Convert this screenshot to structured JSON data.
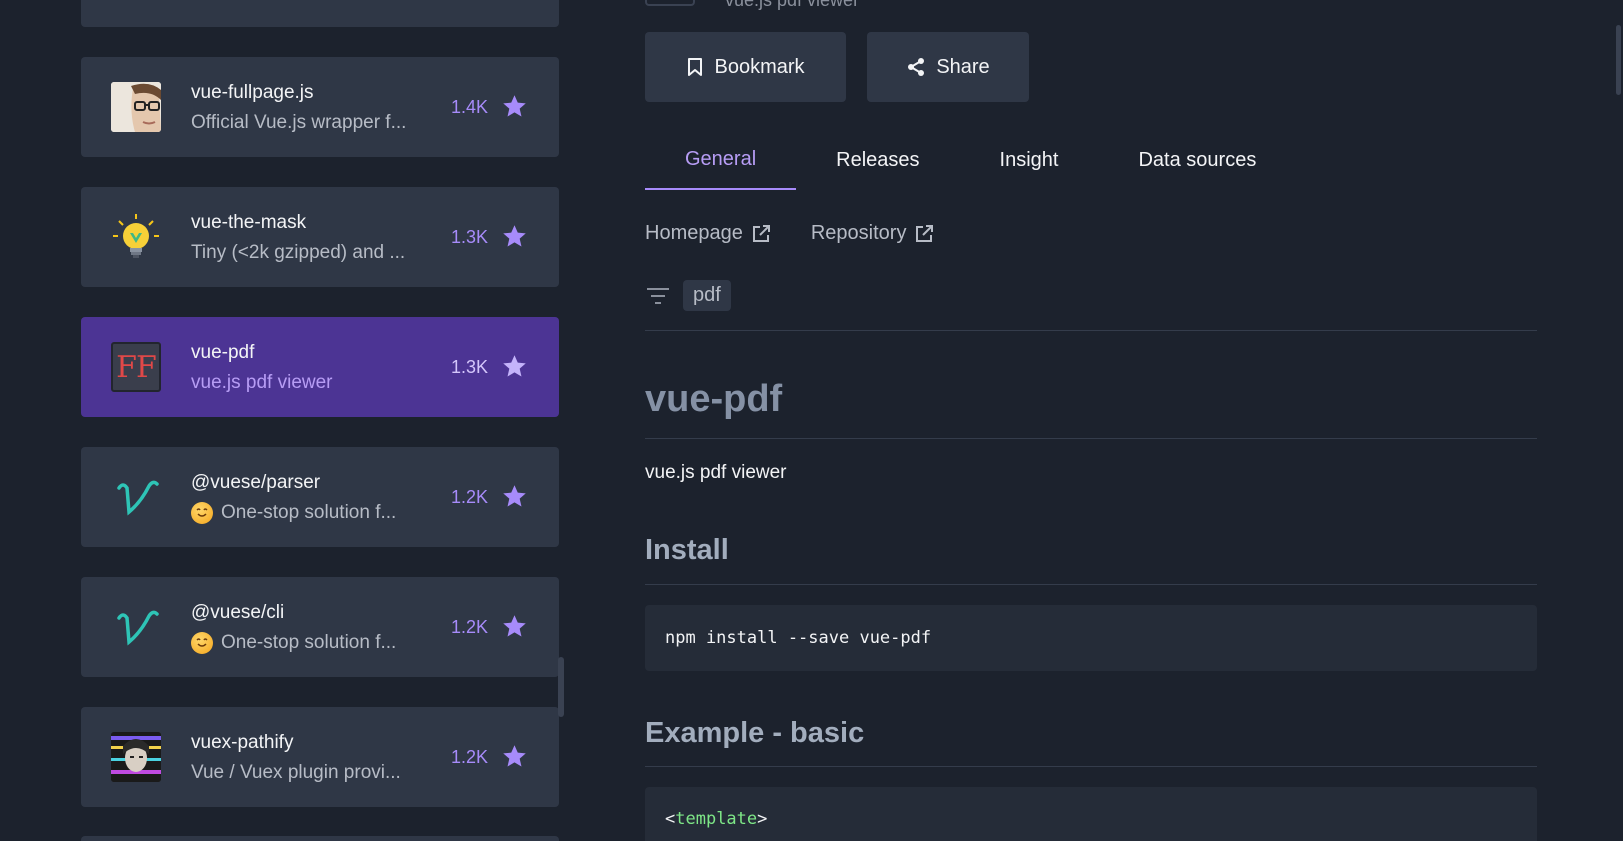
{
  "colors": {
    "page_bg": "#1c222d",
    "card_bg": "#2f3746",
    "selected_card_bg": "#4c3494",
    "accent": "#a78bfa"
  },
  "packages": [
    {
      "name": "vue-fullpage.js",
      "description": "Official Vue.js wrapper f...",
      "stars": "1.4K",
      "avatar": "person-glasses-avatar",
      "selected": false
    },
    {
      "name": "vue-the-mask",
      "description": "Tiny (<2k gzipped) and ...",
      "stars": "1.3K",
      "avatar": "lightbulb-avatar",
      "selected": false
    },
    {
      "name": "vue-pdf",
      "description": "vue.js pdf viewer",
      "stars": "1.3K",
      "avatar": "ff-logo-avatar",
      "selected": true
    },
    {
      "name": "@vuese/parser",
      "description": "One-stop solution f...",
      "stars": "1.2K",
      "avatar": "vuese-logo-avatar",
      "selected": false,
      "emoji": "smiling-face-icon"
    },
    {
      "name": "@vuese/cli",
      "description": "One-stop solution f...",
      "stars": "1.2K",
      "avatar": "vuese-logo-avatar",
      "selected": false,
      "emoji": "smiling-face-icon"
    },
    {
      "name": "vuex-pathify",
      "description": "Vue / Vuex plugin provi...",
      "stars": "1.2K",
      "avatar": "glitch-portrait-avatar",
      "selected": false
    }
  ],
  "detail": {
    "top_peek_text": "vue.js pdf viewer",
    "bookmark_label": "Bookmark",
    "share_label": "Share",
    "tabs": [
      {
        "label": "General",
        "active": true
      },
      {
        "label": "Releases",
        "active": false
      },
      {
        "label": "Insight",
        "active": false
      },
      {
        "label": "Data sources",
        "active": false
      }
    ],
    "homepage_label": "Homepage",
    "repository_label": "Repository",
    "tag": "pdf",
    "readme": {
      "title": "vue-pdf",
      "description": "vue.js pdf viewer",
      "install_heading": "Install",
      "install_code": "npm install --save vue-pdf",
      "example_heading": "Example - basic",
      "example_code_open": "<",
      "example_code_tag": "template",
      "example_code_close": ">"
    }
  }
}
